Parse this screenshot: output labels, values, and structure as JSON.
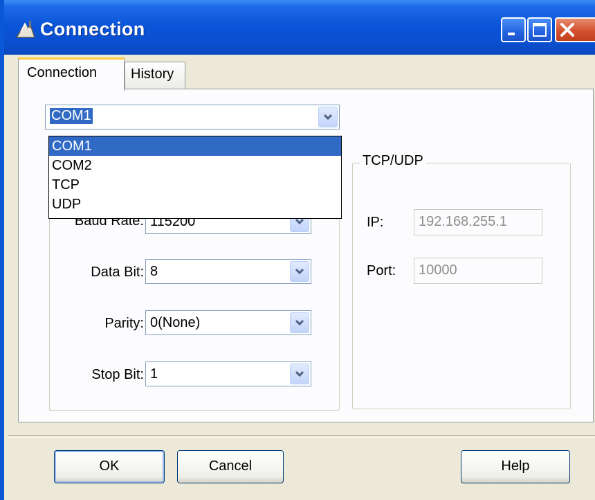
{
  "window": {
    "title": "Connection",
    "accent": "#0A57D8"
  },
  "titlebar_buttons": {
    "minimize": "minimize-icon",
    "maximize": "maximize-icon",
    "close": "close-icon"
  },
  "tabs": [
    {
      "label": "Connection",
      "active": true
    },
    {
      "label": "History",
      "active": false
    }
  ],
  "port_select": {
    "value": "COM1",
    "options": [
      "COM1",
      "COM2",
      "TCP",
      "UDP"
    ],
    "selected_index": 0
  },
  "serial": {
    "baud_rate": {
      "label": "Baud Rate:",
      "value": "115200"
    },
    "data_bit": {
      "label": "Data Bit:",
      "value": "8"
    },
    "parity": {
      "label": "Parity:",
      "value": "0(None)"
    },
    "stop_bit": {
      "label": "Stop Bit:",
      "value": "1"
    }
  },
  "tcp": {
    "title": "TCP/UDP",
    "ip": {
      "label": "IP:",
      "value": "192.168.255.1"
    },
    "port": {
      "label": "Port:",
      "value": "10000"
    }
  },
  "buttons": {
    "ok": "OK",
    "cancel": "Cancel",
    "help": "Help"
  }
}
